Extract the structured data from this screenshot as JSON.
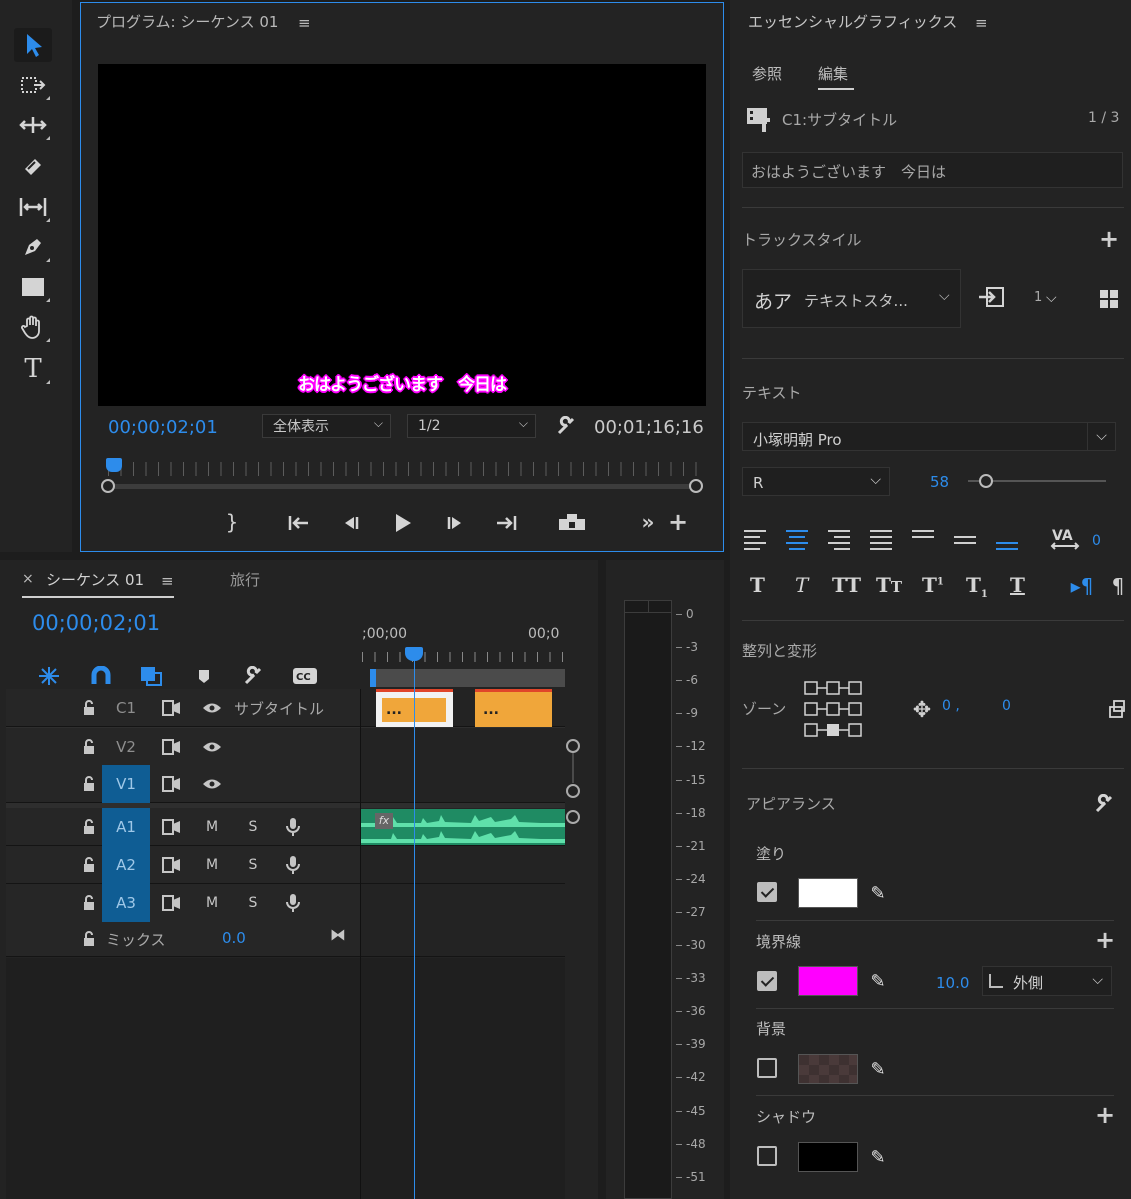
{
  "program": {
    "title": "プログラム: シーケンス 01",
    "timecode": "00;00;02;01",
    "zoom": "全体表示",
    "resolution": "1/2",
    "duration": "00;01;16;16",
    "subtitle": "おはようございます　今日は"
  },
  "timeline": {
    "tab": "シーケンス 01",
    "tab2": "旅行",
    "timecode": "00;00;02;01",
    "ruler_start": ";00;00",
    "ruler_end": "00;0",
    "tracks": [
      {
        "name": "C1",
        "label": "サブタイトル",
        "type": "caption"
      },
      {
        "name": "V2",
        "label": "",
        "type": "video"
      },
      {
        "name": "V1",
        "label": "",
        "type": "video",
        "active": true
      },
      {
        "name": "A1",
        "label": "",
        "type": "audio",
        "active": true
      },
      {
        "name": "A2",
        "label": "",
        "type": "audio",
        "active": true
      },
      {
        "name": "A3",
        "label": "",
        "type": "audio",
        "active": true
      }
    ],
    "mix": {
      "label": "ミックス",
      "value": "0.0"
    },
    "m": "M",
    "s": "S",
    "clip1": "...",
    "clip2": "...",
    "fx": "fx"
  },
  "meter": {
    "ticks": [
      "0",
      "-3",
      "-6",
      "-9",
      "-12",
      "-15",
      "-18",
      "-21",
      "-24",
      "-27",
      "-30",
      "-33",
      "-36",
      "-39",
      "-42",
      "-45",
      "-48",
      "-51"
    ]
  },
  "eg": {
    "title": "エッセンシャルグラフィックス",
    "tab_browse": "参照",
    "tab_edit": "編集",
    "caption_label": "C1:サブタイトル",
    "caption_count": "1 / 3",
    "caption_text": "おはようございます　今日は",
    "track_style_label": "トラックスタイル",
    "style_preview": "あア",
    "style_name": "テキストスタ...",
    "style_count": "1",
    "text_label": "テキスト",
    "font": "小塚明朝 Pro",
    "weight": "R",
    "size": "58",
    "kerning": "0",
    "align_label": "整列と変形",
    "zone_label": "ゾーン",
    "pos_x": "0 ,",
    "pos_y": "0",
    "appearance_label": "アピアランス",
    "fill_label": "塗り",
    "fill_color": "#ffffff",
    "stroke_label": "境界線",
    "stroke_color": "#ff00ff",
    "stroke_width": "10.0",
    "stroke_mode": "外側",
    "bg_label": "背景",
    "shadow_label": "シャドウ",
    "shadow_color": "#000000"
  },
  "colors": {
    "accent": "#2d8ceb",
    "track_active": "#0f5d94",
    "clip": "#f0a63a",
    "audio": "#2ea77a",
    "subtitle_stroke": "#ff00ff"
  }
}
